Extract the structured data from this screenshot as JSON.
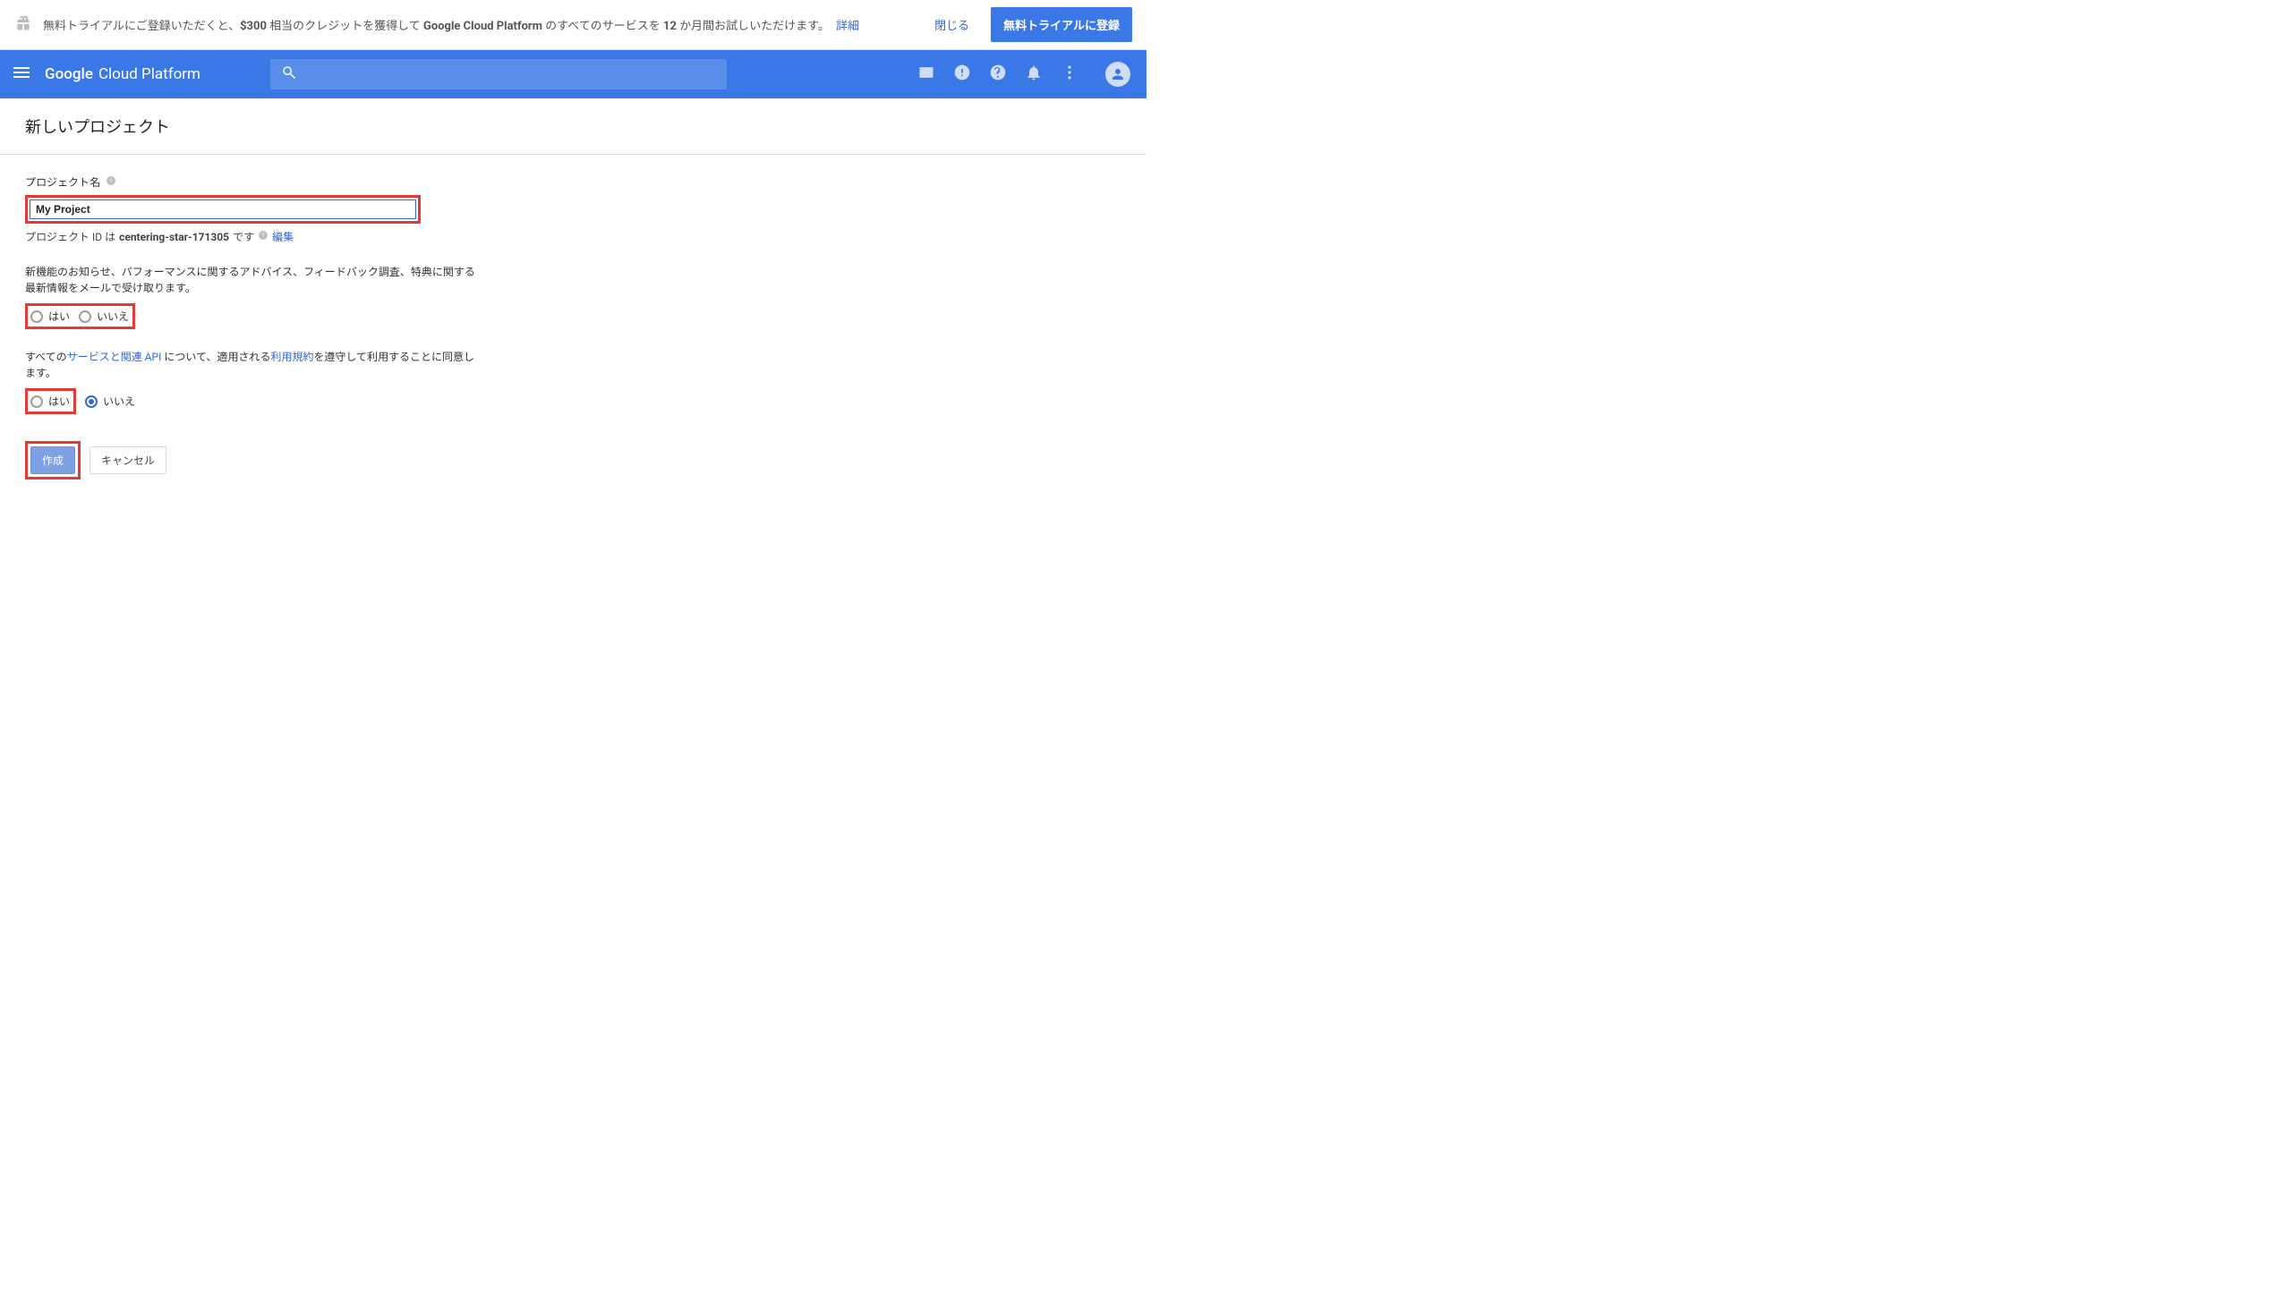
{
  "promo": {
    "text_pre": "無料トライアルにご登録いただくと、",
    "credit_amount": "$300",
    "text_mid": " 相当のクレジットを獲得して ",
    "product": "Google Cloud Platform",
    "text_post": " のすべてのサービスを ",
    "months": "12",
    "text_end": " か月間お試しいただけます。",
    "details_link": "詳細",
    "close_label": "閉じる",
    "cta_label": "無料トライアルに登録"
  },
  "appbar": {
    "brand_google": "Google",
    "brand_rest": "Cloud Platform",
    "search_placeholder": ""
  },
  "page": {
    "title": "新しいプロジェクト"
  },
  "form": {
    "project_name_label": "プロジェクト名",
    "project_name_value": "My Project",
    "project_id_pre": "プロジェクト ID は ",
    "project_id": "centering-star-171305",
    "project_id_post": " です",
    "edit_label": "編集",
    "email_optin_text": "新機能のお知らせ、パフォーマンスに関するアドバイス、フィードバック調査、特典に関する最新情報をメールで受け取ります。",
    "tos_text_pre": "すべての",
    "tos_link1": "サービスと関連 API",
    "tos_text_mid": " について、適用される",
    "tos_link2": "利用規約",
    "tos_text_post": "を遵守して利用することに同意します。",
    "yes_label": "はい",
    "no_label": "いいえ",
    "create_label": "作成",
    "cancel_label": "キャンセル"
  },
  "colors": {
    "primary": "#3b78e7",
    "highlight": "#e53935"
  }
}
